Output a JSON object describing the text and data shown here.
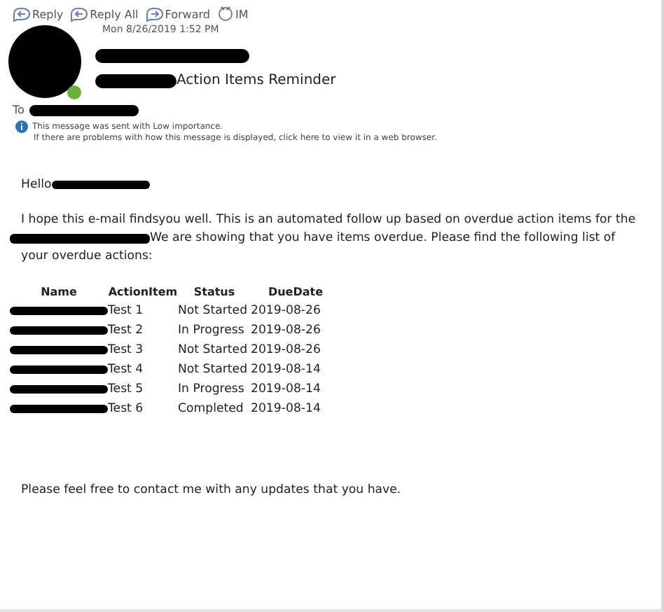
{
  "toolbar": [
    {
      "label": "Reply",
      "kind": "reply"
    },
    {
      "label": "Reply All",
      "kind": "reply_all"
    },
    {
      "label": "Forward",
      "kind": "forward"
    },
    {
      "label": "IM",
      "kind": "im"
    }
  ],
  "message": {
    "date": "Mon 8/26/2019 1:52 PM",
    "subject": "Action Items Reminder",
    "to_label": "To",
    "notice": "This message was sent with Low importance.",
    "view_notice": "If there are problems with how this message is displayed, click here to view it in a web browser."
  },
  "body": {
    "greeting": "Hello",
    "intro_line_1": "I hope this e-mail findsyou well. This is an automated follow up based on overdue action items for the",
    "intro_line_2": "We are showing that you have items overdue. Please find the following list of",
    "intro_line_3": "your overdue actions:",
    "closing": "Please feel free to contact me with any updates that you have."
  },
  "table": {
    "columns": [
      "Name",
      "ActionItem",
      "Status",
      "DueDate"
    ],
    "rows": [
      {
        "action_item": "Test 1",
        "status": "Not Started",
        "due_date": "2019-08-26"
      },
      {
        "action_item": "Test 2",
        "status": "In Progress",
        "due_date": "2019-08-26"
      },
      {
        "action_item": "Test 3",
        "status": "Not Started",
        "due_date": "2019-08-26"
      },
      {
        "action_item": "Test 4",
        "status": "Not Started",
        "due_date": "2019-08-14"
      },
      {
        "action_item": "Test 5",
        "status": "In Progress",
        "due_date": "2019-08-14"
      },
      {
        "action_item": "Test 6",
        "status": "Completed",
        "due_date": "2019-08-14"
      }
    ]
  }
}
